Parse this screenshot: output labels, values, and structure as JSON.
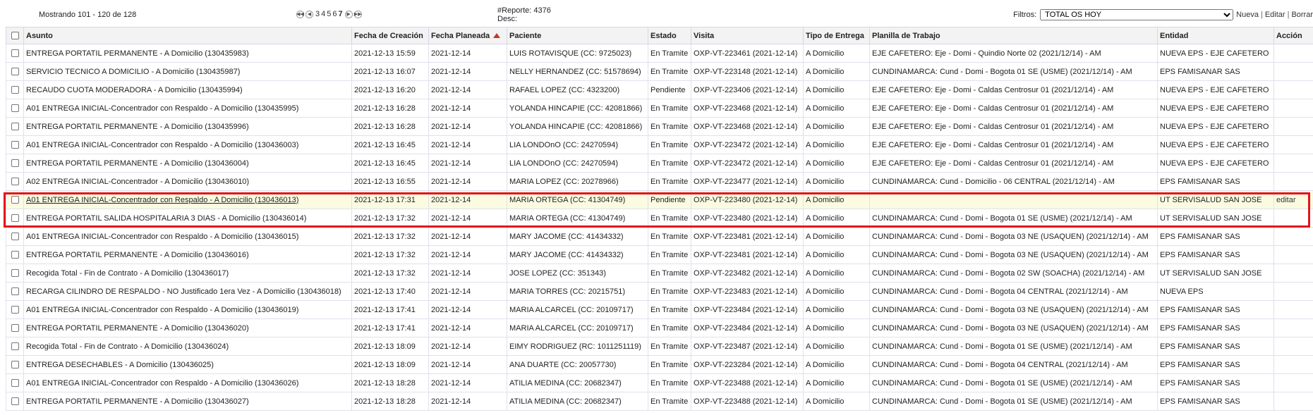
{
  "toolbar": {
    "showing": "Mostrando 101 - 120 de 128",
    "pages": [
      "3",
      "4",
      "5",
      "6",
      "7"
    ],
    "current_page": "7",
    "report_line1": "#Reporte: 4376",
    "report_line2": "Desc:",
    "filters_label": "Filtros:",
    "filter_selected": "TOTAL OS HOY",
    "nueva": "Nueva",
    "editar": "Editar",
    "borrar": "Borrar",
    "separator": "|"
  },
  "columns": [
    "Asunto",
    "Fecha de Creación",
    "Fecha Planeada",
    "Paciente",
    "Estado",
    "Visita",
    "Tipo de Entrega",
    "Planilla de Trabajo",
    "Entidad",
    "Acción"
  ],
  "rows": [
    {
      "asunto": "ENTREGA PORTATIL PERMANENTE - A Domicilio (130435983)",
      "creacion": "2021-12-13 15:59",
      "planeada": "2021-12-14",
      "paciente": "LUIS ROTAVISQUE (CC: 9725023)",
      "estado": "En Tramite",
      "visita": "OXP-VT-223461 (2021-12-14)",
      "tipo": "A Domicilio",
      "planilla": "EJE CAFETERO: Eje - Domi - Quindio Norte 02 (2021/12/14) - AM",
      "entidad": "NUEVA EPS - EJE CAFETERO",
      "accion": ""
    },
    {
      "asunto": "SERVICIO TECNICO A DOMICILIO - A Domicilio (130435987)",
      "creacion": "2021-12-13 16:07",
      "planeada": "2021-12-14",
      "paciente": "NELLY HERNANDEZ (CC: 51578694)",
      "estado": "En Tramite",
      "visita": "OXP-VT-223148 (2021-12-14)",
      "tipo": "A Domicilio",
      "planilla": "CUNDINAMARCA: Cund - Domi - Bogota 01 SE (USME) (2021/12/14) - AM",
      "entidad": "EPS FAMISANAR SAS",
      "accion": ""
    },
    {
      "asunto": "RECAUDO CUOTA MODERADORA - A Domicilio (130435994)",
      "creacion": "2021-12-13 16:20",
      "planeada": "2021-12-14",
      "paciente": "RAFAEL LOPEZ (CC: 4323200)",
      "estado": "Pendiente",
      "visita": "OXP-VT-223406 (2021-12-14)",
      "tipo": "A Domicilio",
      "planilla": "EJE CAFETERO: Eje - Domi - Caldas Centrosur 01 (2021/12/14) - AM",
      "entidad": "NUEVA EPS - EJE CAFETERO",
      "accion": ""
    },
    {
      "asunto": "A01 ENTREGA INICIAL-Concentrador con Respaldo - A Domicilio (130435995)",
      "creacion": "2021-12-13 16:28",
      "planeada": "2021-12-14",
      "paciente": "YOLANDA HINCAPIE (CC: 42081866)",
      "estado": "En Tramite",
      "visita": "OXP-VT-223468 (2021-12-14)",
      "tipo": "A Domicilio",
      "planilla": "EJE CAFETERO: Eje - Domi - Caldas Centrosur 01 (2021/12/14) - AM",
      "entidad": "NUEVA EPS - EJE CAFETERO",
      "accion": ""
    },
    {
      "asunto": "ENTREGA PORTATIL PERMANENTE - A Domicilio (130435996)",
      "creacion": "2021-12-13 16:28",
      "planeada": "2021-12-14",
      "paciente": "YOLANDA HINCAPIE (CC: 42081866)",
      "estado": "En Tramite",
      "visita": "OXP-VT-223468 (2021-12-14)",
      "tipo": "A Domicilio",
      "planilla": "EJE CAFETERO: Eje - Domi - Caldas Centrosur 01 (2021/12/14) - AM",
      "entidad": "NUEVA EPS - EJE CAFETERO",
      "accion": ""
    },
    {
      "asunto": "A01 ENTREGA INICIAL-Concentrador con Respaldo - A Domicilio (130436003)",
      "creacion": "2021-12-13 16:45",
      "planeada": "2021-12-14",
      "paciente": "LIA LONDOnO (CC: 24270594)",
      "estado": "En Tramite",
      "visita": "OXP-VT-223472 (2021-12-14)",
      "tipo": "A Domicilio",
      "planilla": "EJE CAFETERO: Eje - Domi - Caldas Centrosur 01 (2021/12/14) - AM",
      "entidad": "NUEVA EPS - EJE CAFETERO",
      "accion": ""
    },
    {
      "asunto": "ENTREGA PORTATIL PERMANENTE - A Domicilio (130436004)",
      "creacion": "2021-12-13 16:45",
      "planeada": "2021-12-14",
      "paciente": "LIA LONDOnO (CC: 24270594)",
      "estado": "En Tramite",
      "visita": "OXP-VT-223472 (2021-12-14)",
      "tipo": "A Domicilio",
      "planilla": "EJE CAFETERO: Eje - Domi - Caldas Centrosur 01 (2021/12/14) - AM",
      "entidad": "NUEVA EPS - EJE CAFETERO",
      "accion": ""
    },
    {
      "asunto": "A02 ENTREGA INICIAL-Concentrador - A Domicilio (130436010)",
      "creacion": "2021-12-13 16:55",
      "planeada": "2021-12-14",
      "paciente": "MARIA LOPEZ (CC: 20278966)",
      "estado": "En Tramite",
      "visita": "OXP-VT-223477 (2021-12-14)",
      "tipo": "A Domicilio",
      "planilla": "CUNDINAMARCA: Cund - Domicilio - 06 CENTRAL (2021/12/14) - AM",
      "entidad": "EPS FAMISANAR SAS",
      "accion": ""
    },
    {
      "asunto": "A01 ENTREGA INICIAL-Concentrador con Respaldo - A Domicilio (130436013)",
      "creacion": "2021-12-13 17:31",
      "planeada": "2021-12-14",
      "paciente": "MARIA ORTEGA (CC: 41304749)",
      "estado": "Pendiente",
      "visita": "OXP-VT-223480 (2021-12-14)",
      "tipo": "A Domicilio",
      "planilla": "",
      "entidad": "UT SERVISALUD SAN JOSE",
      "accion": "editar",
      "highlight": true
    },
    {
      "asunto": "ENTREGA PORTATIL SALIDA HOSPITALARIA 3 DIAS - A Domicilio (130436014)",
      "creacion": "2021-12-13 17:32",
      "planeada": "2021-12-14",
      "paciente": "MARIA ORTEGA (CC: 41304749)",
      "estado": "En Tramite",
      "visita": "OXP-VT-223480 (2021-12-14)",
      "tipo": "A Domicilio",
      "planilla": "CUNDINAMARCA: Cund - Domi - Bogota 01 SE (USME) (2021/12/14) - AM",
      "entidad": "UT SERVISALUD SAN JOSE",
      "accion": ""
    },
    {
      "asunto": "A01 ENTREGA INICIAL-Concentrador con Respaldo - A Domicilio (130436015)",
      "creacion": "2021-12-13 17:32",
      "planeada": "2021-12-14",
      "paciente": "MARY JACOME (CC: 41434332)",
      "estado": "En Tramite",
      "visita": "OXP-VT-223481 (2021-12-14)",
      "tipo": "A Domicilio",
      "planilla": "CUNDINAMARCA: Cund - Domi - Bogota 03 NE (USAQUEN) (2021/12/14) - AM",
      "entidad": "EPS FAMISANAR SAS",
      "accion": ""
    },
    {
      "asunto": "ENTREGA PORTATIL PERMANENTE - A Domicilio (130436016)",
      "creacion": "2021-12-13 17:32",
      "planeada": "2021-12-14",
      "paciente": "MARY JACOME (CC: 41434332)",
      "estado": "En Tramite",
      "visita": "OXP-VT-223481 (2021-12-14)",
      "tipo": "A Domicilio",
      "planilla": "CUNDINAMARCA: Cund - Domi - Bogota 03 NE (USAQUEN) (2021/12/14) - AM",
      "entidad": "EPS FAMISANAR SAS",
      "accion": ""
    },
    {
      "asunto": "Recogida Total - Fin de Contrato - A Domicilio (130436017)",
      "creacion": "2021-12-13 17:32",
      "planeada": "2021-12-14",
      "paciente": "JOSE LOPEZ (CC: 351343)",
      "estado": "En Tramite",
      "visita": "OXP-VT-223482 (2021-12-14)",
      "tipo": "A Domicilio",
      "planilla": "CUNDINAMARCA: Cund - Domi - Bogota 02 SW (SOACHA) (2021/12/14) - AM",
      "entidad": "UT SERVISALUD SAN JOSE",
      "accion": ""
    },
    {
      "asunto": "RECARGA CILINDRO DE RESPALDO - NO Justificado 1era Vez - A Domicilio (130436018)",
      "creacion": "2021-12-13 17:40",
      "planeada": "2021-12-14",
      "paciente": "MARIA TORRES (CC: 20215751)",
      "estado": "En Tramite",
      "visita": "OXP-VT-223483 (2021-12-14)",
      "tipo": "A Domicilio",
      "planilla": "CUNDINAMARCA: Cund - Domi - Bogota 04 CENTRAL (2021/12/14) - AM",
      "entidad": "NUEVA EPS",
      "accion": ""
    },
    {
      "asunto": "A01 ENTREGA INICIAL-Concentrador con Respaldo - A Domicilio (130436019)",
      "creacion": "2021-12-13 17:41",
      "planeada": "2021-12-14",
      "paciente": "MARIA ALCARCEL (CC: 20109717)",
      "estado": "En Tramite",
      "visita": "OXP-VT-223484 (2021-12-14)",
      "tipo": "A Domicilio",
      "planilla": "CUNDINAMARCA: Cund - Domi - Bogota 03 NE (USAQUEN) (2021/12/14) - AM",
      "entidad": "EPS FAMISANAR SAS",
      "accion": ""
    },
    {
      "asunto": "ENTREGA PORTATIL PERMANENTE - A Domicilio (130436020)",
      "creacion": "2021-12-13 17:41",
      "planeada": "2021-12-14",
      "paciente": "MARIA ALCARCEL (CC: 20109717)",
      "estado": "En Tramite",
      "visita": "OXP-VT-223484 (2021-12-14)",
      "tipo": "A Domicilio",
      "planilla": "CUNDINAMARCA: Cund - Domi - Bogota 03 NE (USAQUEN) (2021/12/14) - AM",
      "entidad": "EPS FAMISANAR SAS",
      "accion": ""
    },
    {
      "asunto": "Recogida Total - Fin de Contrato - A Domicilio (130436024)",
      "creacion": "2021-12-13 18:09",
      "planeada": "2021-12-14",
      "paciente": "EIMY RODRIGUEZ (RC: 1011251119)",
      "estado": "En Tramite",
      "visita": "OXP-VT-223487 (2021-12-14)",
      "tipo": "A Domicilio",
      "planilla": "CUNDINAMARCA: Cund - Domi - Bogota 01 SE (USME) (2021/12/14) - AM",
      "entidad": "EPS FAMISANAR SAS",
      "accion": ""
    },
    {
      "asunto": "ENTREGA DESECHABLES - A Domicilio (130436025)",
      "creacion": "2021-12-13 18:09",
      "planeada": "2021-12-14",
      "paciente": "ANA DUARTE (CC: 20057730)",
      "estado": "En Tramite",
      "visita": "OXP-VT-223284 (2021-12-14)",
      "tipo": "A Domicilio",
      "planilla": "CUNDINAMARCA: Cund - Domi - Bogota 04 CENTRAL (2021/12/14) - AM",
      "entidad": "EPS FAMISANAR SAS",
      "accion": ""
    },
    {
      "asunto": "A01 ENTREGA INICIAL-Concentrador con Respaldo - A Domicilio (130436026)",
      "creacion": "2021-12-13 18:28",
      "planeada": "2021-12-14",
      "paciente": "ATILIA MEDINA (CC: 20682347)",
      "estado": "En Tramite",
      "visita": "OXP-VT-223488 (2021-12-14)",
      "tipo": "A Domicilio",
      "planilla": "CUNDINAMARCA: Cund - Domi - Bogota 01 SE (USME) (2021/12/14) - AM",
      "entidad": "EPS FAMISANAR SAS",
      "accion": ""
    },
    {
      "asunto": "ENTREGA PORTATIL PERMANENTE - A Domicilio (130436027)",
      "creacion": "2021-12-13 18:28",
      "planeada": "2021-12-14",
      "paciente": "ATILIA MEDINA (CC: 20682347)",
      "estado": "En Tramite",
      "visita": "OXP-VT-223488 (2021-12-14)",
      "tipo": "A Domicilio",
      "planilla": "CUNDINAMARCA: Cund - Domi - Bogota 01 SE (USME) (2021/12/14) - AM",
      "entidad": "EPS FAMISANAR SAS",
      "accion": ""
    }
  ],
  "colors": {
    "highlight_row": "#fbfbe2",
    "annotation_box": "#e3141c",
    "sort_icon": "#c0392b"
  }
}
